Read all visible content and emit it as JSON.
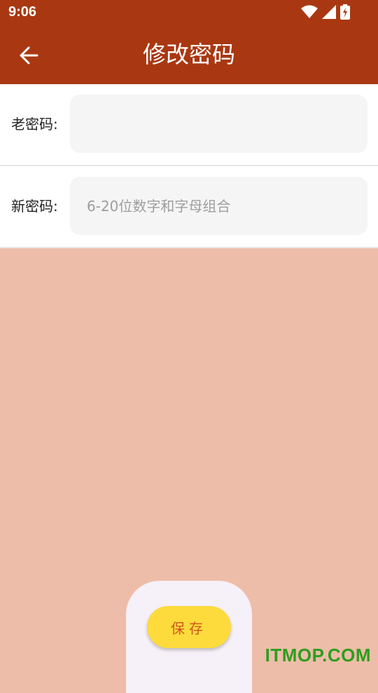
{
  "status_bar": {
    "time": "9:06"
  },
  "app_bar": {
    "title": "修改密码"
  },
  "form": {
    "old_password": {
      "label": "老密码:",
      "value": "",
      "placeholder": ""
    },
    "new_password": {
      "label": "新密码:",
      "value": "",
      "placeholder": "6-20位数字和字母组合"
    }
  },
  "actions": {
    "save_label": "保存"
  },
  "watermark": "ITMOP.COM",
  "colors": {
    "primary": "#a93812",
    "background": "#eebda9",
    "button": "#fddb3c",
    "button_text": "#d4541b"
  }
}
